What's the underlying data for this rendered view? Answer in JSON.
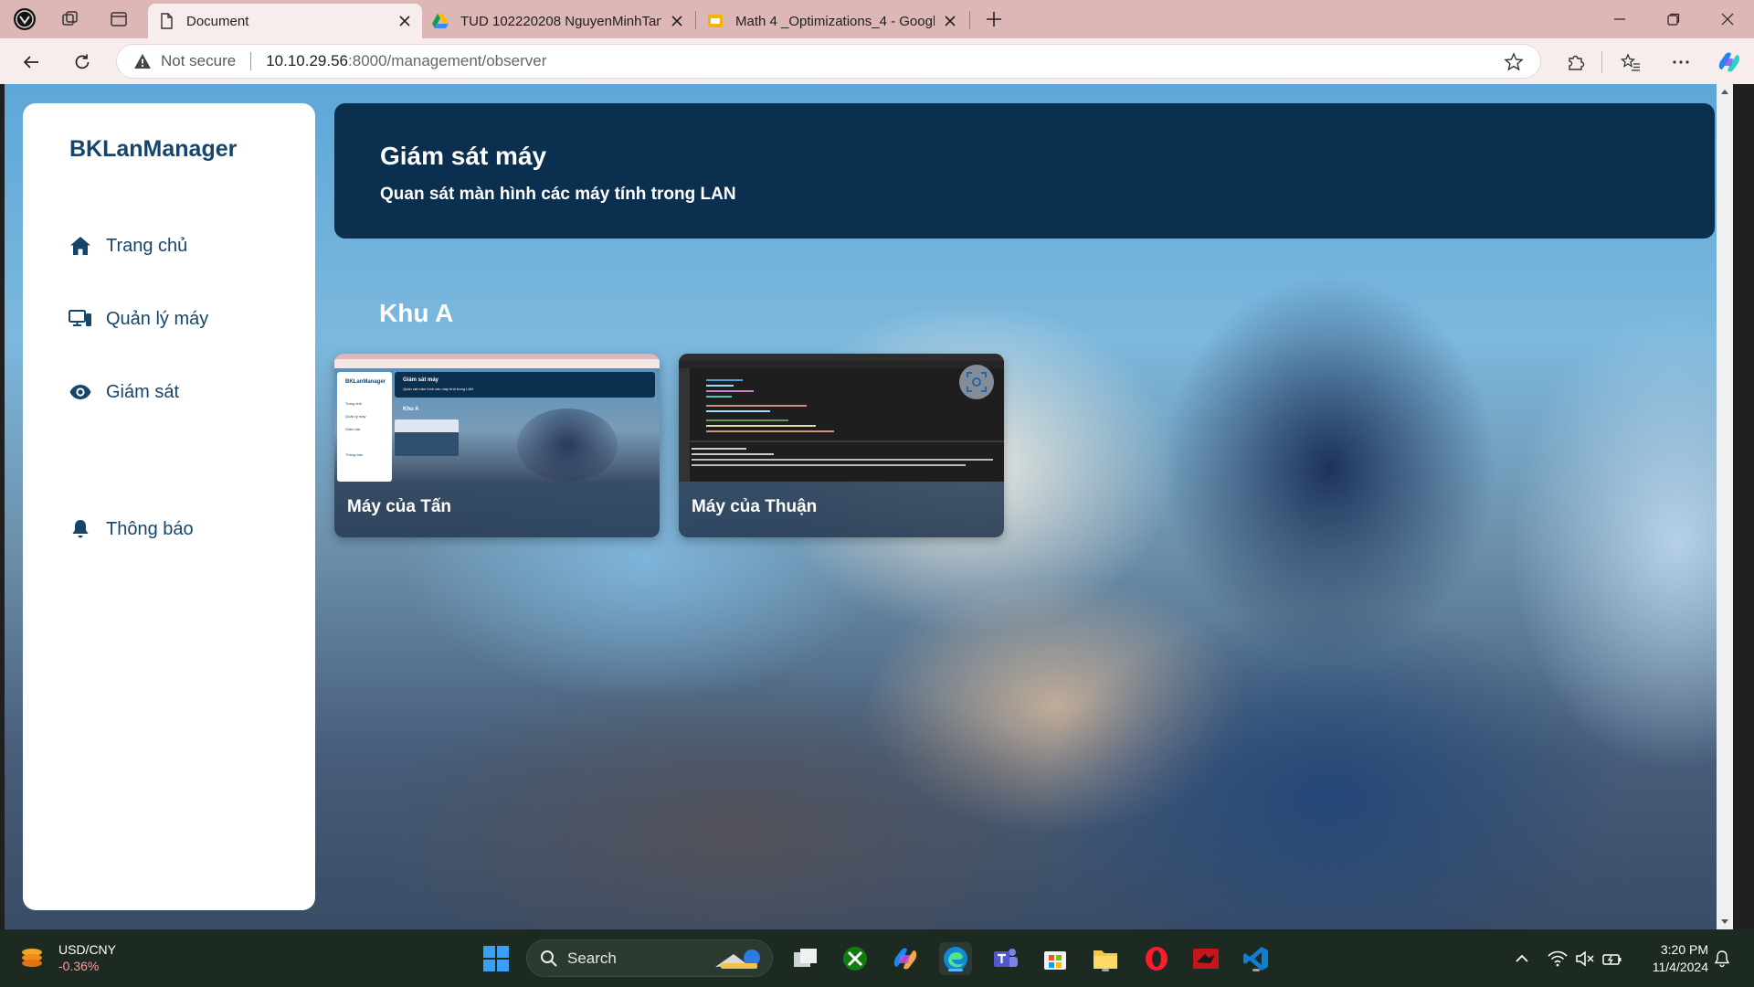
{
  "browser": {
    "tabs": [
      {
        "title": "Document",
        "active": true
      },
      {
        "title": "TUD 102220208 NguyenMinhTan",
        "active": false
      },
      {
        "title": "Math 4 _Optimizations_4 - Googl",
        "active": false
      }
    ],
    "address": {
      "security_label": "Not secure",
      "url_host": "10.10.29.56",
      "url_rest": ":8000/management/observer"
    }
  },
  "sidebar": {
    "brand": "BKLanManager",
    "items": [
      {
        "label": "Trang chủ",
        "icon": "home-icon"
      },
      {
        "label": "Quản lý máy",
        "icon": "devices-icon"
      },
      {
        "label": "Giám sát",
        "icon": "eye-icon"
      },
      {
        "label": "Thông báo",
        "icon": "bell-icon"
      }
    ]
  },
  "header": {
    "title": "Giám sát máy",
    "subtitle": "Quan sát màn hình các máy tính trong LAN"
  },
  "zones": [
    {
      "name": "Khu A",
      "machines": [
        {
          "name": "Máy của Tấn"
        },
        {
          "name": "Máy của Thuận"
        }
      ]
    }
  ],
  "thumbnail_1": {
    "brand": "BKLanManager",
    "title": "Giám sát máy",
    "subtitle": "Quan sát màn hình các máy tính trong LAN",
    "zone": "Khu A",
    "nav": [
      "Trang chủ",
      "Quản lý máy",
      "Giám sát",
      "Thông báo"
    ]
  },
  "taskbar": {
    "widget": {
      "name": "USD/CNY",
      "change": "-0.36%"
    },
    "search_label": "Search",
    "clock": {
      "time": "3:20 PM",
      "date": "11/4/2024"
    }
  },
  "colors": {
    "brand_navy": "#0b2f4e",
    "brand_text": "#16456b",
    "tab_strip": "#ddb6b6"
  }
}
